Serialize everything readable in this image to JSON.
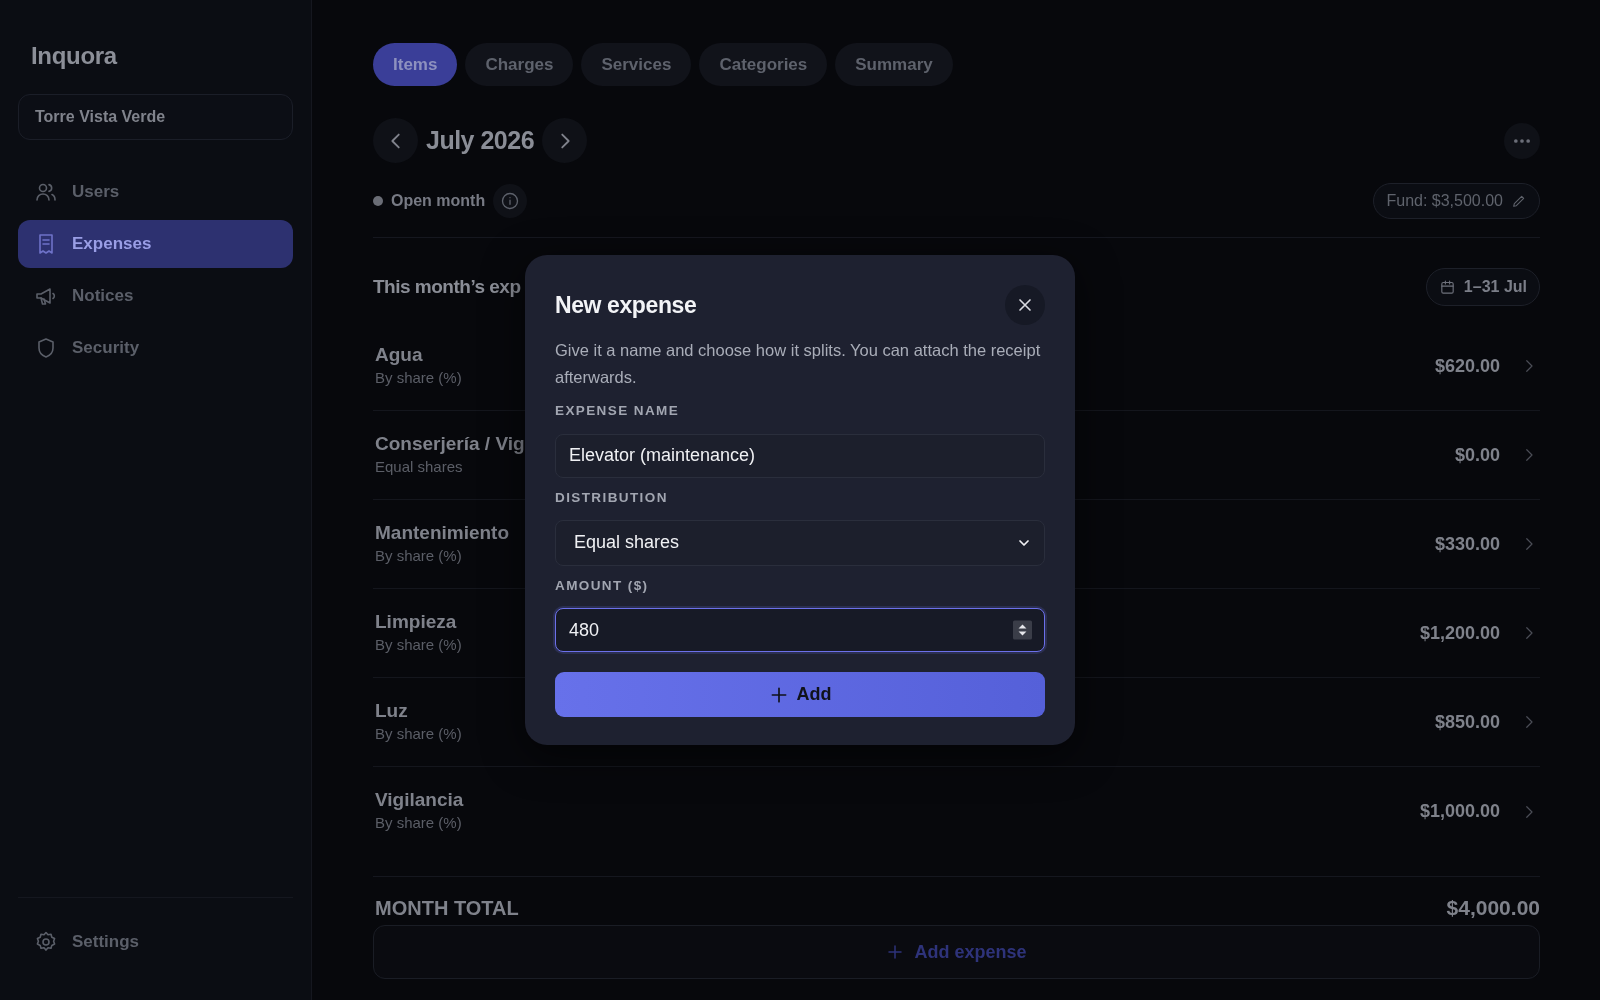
{
  "brand": "Inquora",
  "building": "Torre Vista Verde",
  "sidebar": {
    "items": [
      {
        "label": "Users",
        "selected": false
      },
      {
        "label": "Expenses",
        "selected": true
      },
      {
        "label": "Notices",
        "selected": false
      },
      {
        "label": "Security",
        "selected": false
      }
    ],
    "footer": {
      "label": "Settings"
    }
  },
  "tabs": [
    {
      "label": "Items",
      "selected": true
    },
    {
      "label": "Charges",
      "selected": false
    },
    {
      "label": "Services",
      "selected": false
    },
    {
      "label": "Categories",
      "selected": false
    },
    {
      "label": "Summary",
      "selected": false
    }
  ],
  "month": {
    "title": "July 2026",
    "status": "Open month",
    "fund": "Fund: $3,500.00"
  },
  "section": {
    "title": "This month’s exp",
    "range": "1–31 Jul"
  },
  "expenses": [
    {
      "name": "Agua",
      "split": "By share (%)",
      "amount": "$620.00"
    },
    {
      "name": "Conserjería / Vig",
      "split": "Equal shares",
      "amount": "$0.00"
    },
    {
      "name": "Mantenimiento",
      "split": "By share (%)",
      "amount": "$330.00"
    },
    {
      "name": "Limpieza",
      "split": "By share (%)",
      "amount": "$1,200.00"
    },
    {
      "name": "Luz",
      "split": "By share (%)",
      "amount": "$850.00"
    },
    {
      "name": "Vigilancia",
      "split": "By share (%)",
      "amount": "$1,000.00"
    }
  ],
  "total": {
    "label": "MONTH TOTAL",
    "amount": "$4,000.00"
  },
  "add_expense": "Add expense",
  "modal": {
    "title": "New expense",
    "description": "Give it a name and choose how it splits. You can attach the receipt afterwards.",
    "fields": [
      {
        "kind": "text",
        "label": "EXPENSE NAME",
        "value": "Elevator (maintenance)",
        "focused": false
      },
      {
        "kind": "select",
        "label": "DISTRIBUTION",
        "value": "Equal shares",
        "focused": false
      },
      {
        "kind": "number",
        "label": "AMOUNT ($)",
        "value": "480",
        "focused": true
      }
    ],
    "submit": "Add"
  }
}
